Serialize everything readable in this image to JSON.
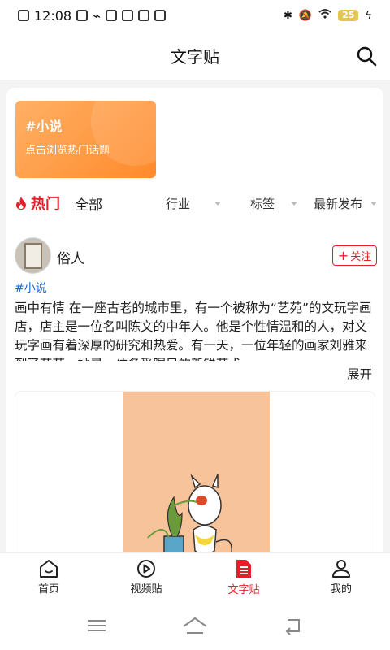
{
  "status_bar": {
    "time": "12:08",
    "battery": "25"
  },
  "header": {
    "title": "文字贴"
  },
  "banner": {
    "title": "#小说",
    "subtitle": "点击浏览热门话题"
  },
  "filters": {
    "hot": "热门",
    "all": "全部",
    "industry": "行业",
    "tags": "标签",
    "latest": "最新发布"
  },
  "post": {
    "username": "俗人",
    "follow_label": "关注",
    "tag": "#小说",
    "text": "画中有情 在一座古老的城市里，有一个被称为“艺苑”的文玩字画店，店主是一位名叫陈文的中年人。他是个性情温和的人，对文玩字画有着深厚的研究和热爱。有一天，一位年轻的画家刘雅来到了艺苑，她是一位备受瞩目的新锐艺术…",
    "expand_label": "展开"
  },
  "bottom_nav": [
    {
      "label": "首页"
    },
    {
      "label": "视频贴"
    },
    {
      "label": "文字贴"
    },
    {
      "label": "我的"
    }
  ],
  "colors": {
    "accent": "#e3202a",
    "banner_start": "#ffb066",
    "banner_end": "#ff8a2a",
    "tag": "#1a6ad6"
  }
}
